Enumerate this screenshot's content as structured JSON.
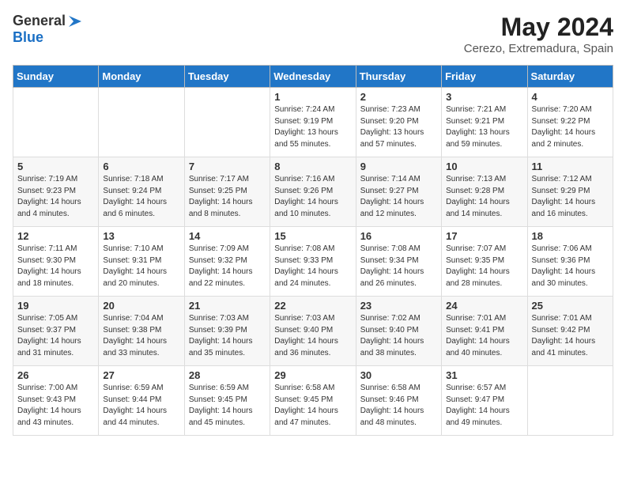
{
  "logo": {
    "text_general": "General",
    "text_blue": "Blue"
  },
  "header": {
    "month": "May 2024",
    "location": "Cerezo, Extremadura, Spain"
  },
  "weekdays": [
    "Sunday",
    "Monday",
    "Tuesday",
    "Wednesday",
    "Thursday",
    "Friday",
    "Saturday"
  ],
  "weeks": [
    [
      {
        "day": "",
        "info": ""
      },
      {
        "day": "",
        "info": ""
      },
      {
        "day": "",
        "info": ""
      },
      {
        "day": "1",
        "info": "Sunrise: 7:24 AM\nSunset: 9:19 PM\nDaylight: 13 hours\nand 55 minutes."
      },
      {
        "day": "2",
        "info": "Sunrise: 7:23 AM\nSunset: 9:20 PM\nDaylight: 13 hours\nand 57 minutes."
      },
      {
        "day": "3",
        "info": "Sunrise: 7:21 AM\nSunset: 9:21 PM\nDaylight: 13 hours\nand 59 minutes."
      },
      {
        "day": "4",
        "info": "Sunrise: 7:20 AM\nSunset: 9:22 PM\nDaylight: 14 hours\nand 2 minutes."
      }
    ],
    [
      {
        "day": "5",
        "info": "Sunrise: 7:19 AM\nSunset: 9:23 PM\nDaylight: 14 hours\nand 4 minutes."
      },
      {
        "day": "6",
        "info": "Sunrise: 7:18 AM\nSunset: 9:24 PM\nDaylight: 14 hours\nand 6 minutes."
      },
      {
        "day": "7",
        "info": "Sunrise: 7:17 AM\nSunset: 9:25 PM\nDaylight: 14 hours\nand 8 minutes."
      },
      {
        "day": "8",
        "info": "Sunrise: 7:16 AM\nSunset: 9:26 PM\nDaylight: 14 hours\nand 10 minutes."
      },
      {
        "day": "9",
        "info": "Sunrise: 7:14 AM\nSunset: 9:27 PM\nDaylight: 14 hours\nand 12 minutes."
      },
      {
        "day": "10",
        "info": "Sunrise: 7:13 AM\nSunset: 9:28 PM\nDaylight: 14 hours\nand 14 minutes."
      },
      {
        "day": "11",
        "info": "Sunrise: 7:12 AM\nSunset: 9:29 PM\nDaylight: 14 hours\nand 16 minutes."
      }
    ],
    [
      {
        "day": "12",
        "info": "Sunrise: 7:11 AM\nSunset: 9:30 PM\nDaylight: 14 hours\nand 18 minutes."
      },
      {
        "day": "13",
        "info": "Sunrise: 7:10 AM\nSunset: 9:31 PM\nDaylight: 14 hours\nand 20 minutes."
      },
      {
        "day": "14",
        "info": "Sunrise: 7:09 AM\nSunset: 9:32 PM\nDaylight: 14 hours\nand 22 minutes."
      },
      {
        "day": "15",
        "info": "Sunrise: 7:08 AM\nSunset: 9:33 PM\nDaylight: 14 hours\nand 24 minutes."
      },
      {
        "day": "16",
        "info": "Sunrise: 7:08 AM\nSunset: 9:34 PM\nDaylight: 14 hours\nand 26 minutes."
      },
      {
        "day": "17",
        "info": "Sunrise: 7:07 AM\nSunset: 9:35 PM\nDaylight: 14 hours\nand 28 minutes."
      },
      {
        "day": "18",
        "info": "Sunrise: 7:06 AM\nSunset: 9:36 PM\nDaylight: 14 hours\nand 30 minutes."
      }
    ],
    [
      {
        "day": "19",
        "info": "Sunrise: 7:05 AM\nSunset: 9:37 PM\nDaylight: 14 hours\nand 31 minutes."
      },
      {
        "day": "20",
        "info": "Sunrise: 7:04 AM\nSunset: 9:38 PM\nDaylight: 14 hours\nand 33 minutes."
      },
      {
        "day": "21",
        "info": "Sunrise: 7:03 AM\nSunset: 9:39 PM\nDaylight: 14 hours\nand 35 minutes."
      },
      {
        "day": "22",
        "info": "Sunrise: 7:03 AM\nSunset: 9:40 PM\nDaylight: 14 hours\nand 36 minutes."
      },
      {
        "day": "23",
        "info": "Sunrise: 7:02 AM\nSunset: 9:40 PM\nDaylight: 14 hours\nand 38 minutes."
      },
      {
        "day": "24",
        "info": "Sunrise: 7:01 AM\nSunset: 9:41 PM\nDaylight: 14 hours\nand 40 minutes."
      },
      {
        "day": "25",
        "info": "Sunrise: 7:01 AM\nSunset: 9:42 PM\nDaylight: 14 hours\nand 41 minutes."
      }
    ],
    [
      {
        "day": "26",
        "info": "Sunrise: 7:00 AM\nSunset: 9:43 PM\nDaylight: 14 hours\nand 43 minutes."
      },
      {
        "day": "27",
        "info": "Sunrise: 6:59 AM\nSunset: 9:44 PM\nDaylight: 14 hours\nand 44 minutes."
      },
      {
        "day": "28",
        "info": "Sunrise: 6:59 AM\nSunset: 9:45 PM\nDaylight: 14 hours\nand 45 minutes."
      },
      {
        "day": "29",
        "info": "Sunrise: 6:58 AM\nSunset: 9:45 PM\nDaylight: 14 hours\nand 47 minutes."
      },
      {
        "day": "30",
        "info": "Sunrise: 6:58 AM\nSunset: 9:46 PM\nDaylight: 14 hours\nand 48 minutes."
      },
      {
        "day": "31",
        "info": "Sunrise: 6:57 AM\nSunset: 9:47 PM\nDaylight: 14 hours\nand 49 minutes."
      },
      {
        "day": "",
        "info": ""
      }
    ]
  ]
}
